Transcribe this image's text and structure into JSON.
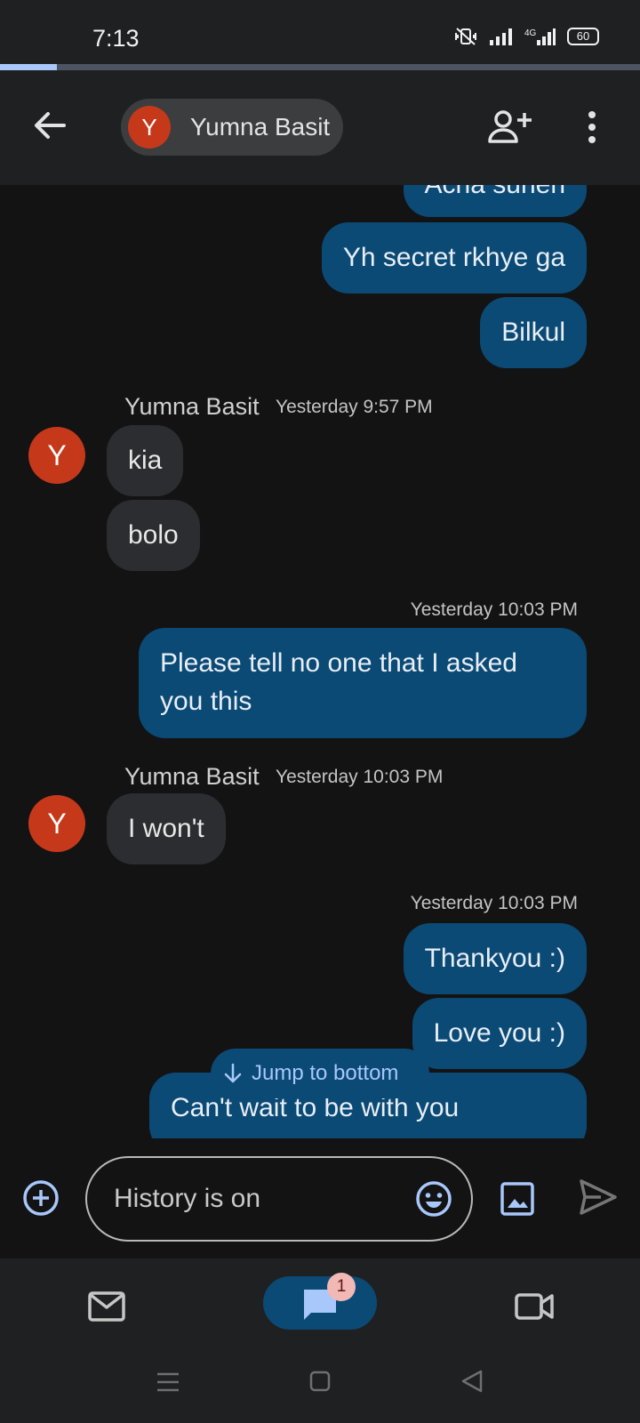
{
  "status_bar": {
    "time": "7:13",
    "battery": "60",
    "network": "4G"
  },
  "header": {
    "contact_initial": "Y",
    "contact_name": "Yumna Basit"
  },
  "messages": {
    "out_1": "Acha suneh",
    "out_2": "Yh secret rkhye ga",
    "out_3": "Bilkul",
    "group_1": {
      "sender": "Yumna Basit",
      "timestamp": "Yesterday 9:57 PM",
      "initial": "Y"
    },
    "in_1": "kia",
    "in_2": "bolo",
    "ts_out_1": "Yesterday 10:03 PM",
    "out_4_line1": "Please tell no one that I asked",
    "out_4_line2": "you this",
    "group_2": {
      "sender": "Yumna Basit",
      "timestamp": "Yesterday 10:03 PM",
      "initial": "Y"
    },
    "in_3": "I won't",
    "ts_out_2": "Yesterday 10:03 PM",
    "out_5": "Thankyou :)",
    "out_6": "Love you :)",
    "out_7": "Can't wait to be with you"
  },
  "jump_to_bottom": "Jump to bottom",
  "compose": {
    "placeholder": "History is on"
  },
  "bottom_nav": {
    "chat_badge": "1"
  },
  "colors": {
    "outgoing": "#0b4a75",
    "incoming": "#2c2d30",
    "avatar": "#c5391a",
    "accent": "#a8c7fa"
  }
}
